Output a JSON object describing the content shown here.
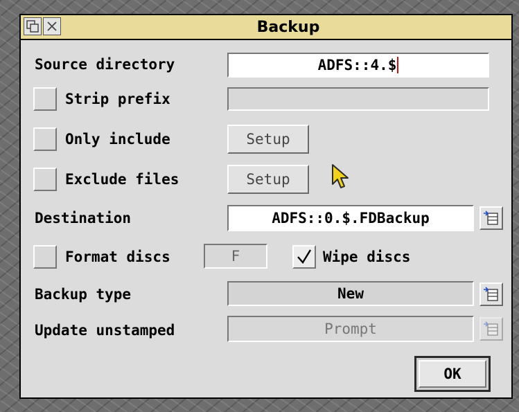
{
  "window": {
    "title": "Backup",
    "titlebar_icons": [
      "back-icon",
      "close-icon"
    ]
  },
  "source": {
    "label": "Source directory",
    "value": "ADFS::4.$"
  },
  "strip_prefix": {
    "label": "Strip prefix",
    "value": "",
    "checked": false
  },
  "only_include": {
    "label": "Only include",
    "button": "Setup",
    "checked": false
  },
  "exclude_files": {
    "label": "Exclude files",
    "button": "Setup",
    "checked": false
  },
  "destination": {
    "label": "Destination",
    "value": "ADFS::0.$.FDBackup"
  },
  "format_discs": {
    "label": "Format discs",
    "value": "F",
    "checked": false
  },
  "wipe_discs": {
    "label": "Wipe discs",
    "checked": true
  },
  "backup_type": {
    "label": "Backup type",
    "value": "New"
  },
  "update_unstamped": {
    "label": "Update unstamped",
    "value": "Prompt"
  },
  "ok_button": "OK",
  "colors": {
    "titlebar": "#e9dc9a",
    "window": "#dcdcdc",
    "caret": "#d01010",
    "pointer": "#f2d21a"
  }
}
